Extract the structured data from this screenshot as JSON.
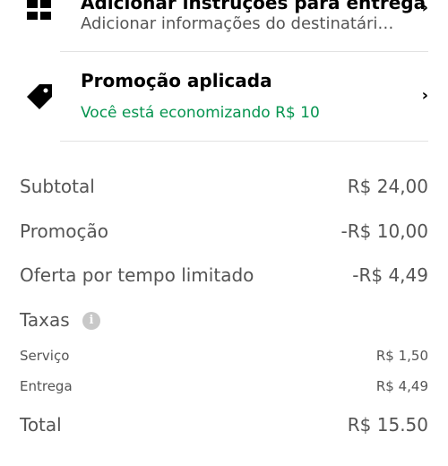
{
  "recipient_row": {
    "title_partial": "Adicionar instruções para entrega",
    "subtitle": "Adicionar informações do destinatário ...",
    "icon": "grid-icon",
    "chevron": "›"
  },
  "promo_row": {
    "title": "Promoção aplicada",
    "subtitle": "Você está economizando R$ 10",
    "icon": "tag-icon",
    "chevron": "›",
    "accent_color": "#05944f"
  },
  "summary": {
    "subtotal": {
      "label": "Subtotal",
      "value": "R$ 24,00"
    },
    "promotion": {
      "label": "Promoção",
      "value": "-R$ 10,00"
    },
    "limited_offer": {
      "label": "Oferta por tempo limitado",
      "value": "-R$ 4,49"
    },
    "fees": {
      "label": "Taxas",
      "info_icon": "i",
      "items": [
        {
          "label": "Serviço",
          "value": "R$ 1,50"
        },
        {
          "label": "Entrega",
          "value": "R$ 4,49"
        }
      ]
    },
    "total": {
      "label": "Total",
      "value": "R$ 15.50"
    }
  }
}
